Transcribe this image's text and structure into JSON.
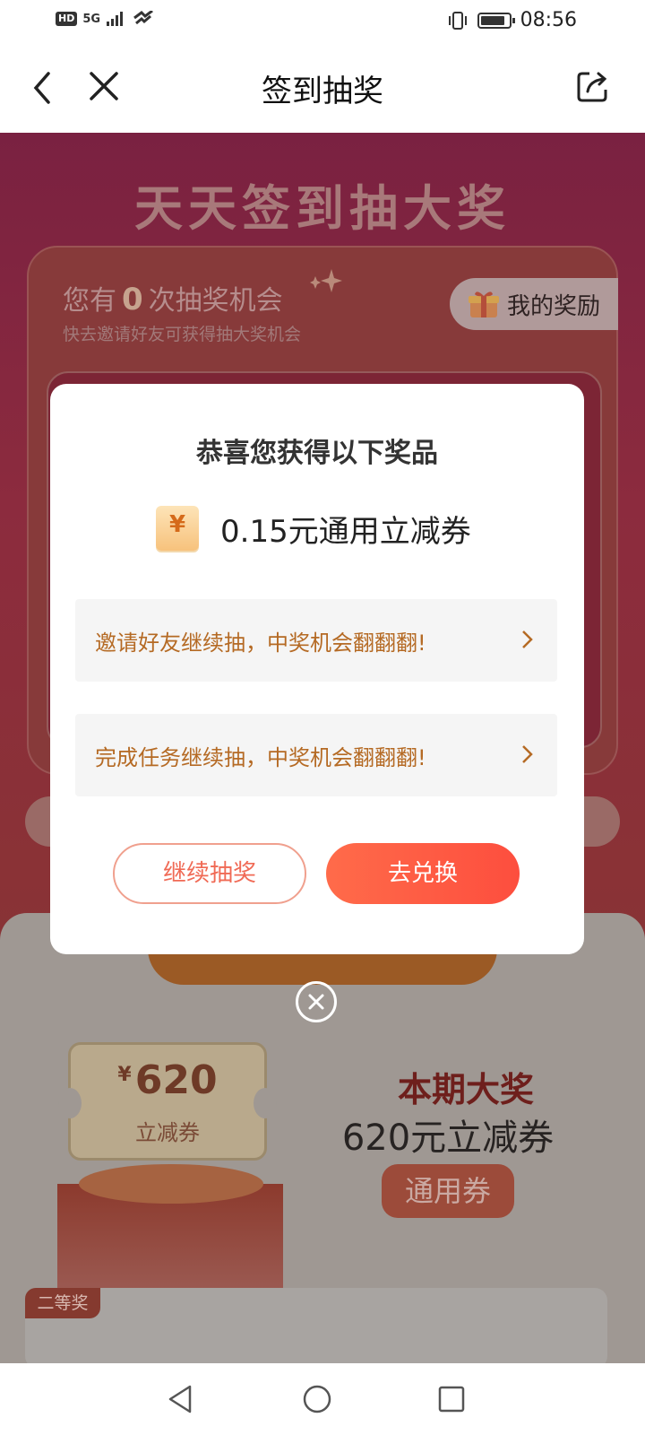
{
  "status_bar": {
    "network_badge": "HD",
    "signal_label": "5G",
    "time": "08:56"
  },
  "navbar": {
    "title": "签到抽奖"
  },
  "banner": {
    "title": "天天签到抽大奖"
  },
  "lottery": {
    "chance_prefix": "您有",
    "chance_count": "0",
    "chance_suffix": "次抽奖机会",
    "chance_hint": "快去邀请好友可获得抽大奖机会",
    "my_rewards_label": "我的奖励"
  },
  "grand_prize": {
    "ticket_currency": "¥",
    "ticket_amount": "620",
    "ticket_label": "立减券",
    "title": "本期大奖",
    "name": "620元立减券",
    "tag": "通用券"
  },
  "second_prize": {
    "tag": "二等奖"
  },
  "modal": {
    "title": "恭喜您获得以下奖品",
    "coupon_symbol": "¥",
    "prize_text": "0.15元通用立减券",
    "action_1": "邀请好友继续抽，中奖机会翻翻翻!",
    "action_2": "完成任务继续抽，中奖机会翻翻翻!",
    "continue_button": "继续抽奖",
    "redeem_button": "去兑换"
  }
}
